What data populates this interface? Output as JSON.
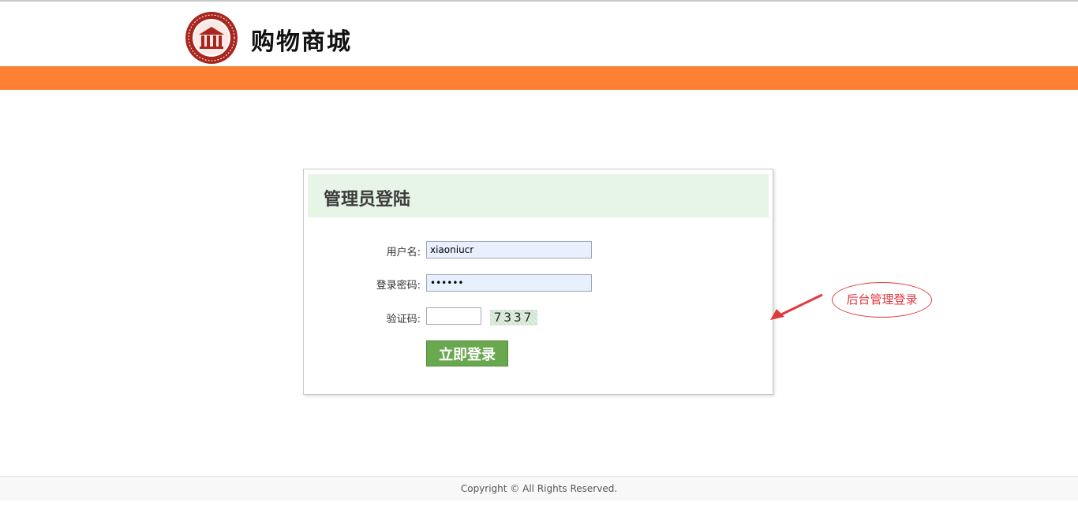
{
  "header": {
    "site_title": "购物商城",
    "logo_icon": "university-seal-logo",
    "brand_color": "#fe8034"
  },
  "login": {
    "title": "管理员登陆",
    "username_label": "用户名:",
    "username_value": "xiaoniucr",
    "password_label": "登录密码:",
    "password_value": "••••••",
    "captcha_label": "验证码:",
    "captcha_value": "",
    "captcha_text": "7337",
    "submit_label": "立即登录",
    "head_color": "#e7f5e7",
    "button_color": "#6aa84f"
  },
  "annotation": {
    "text": "后台管理登录",
    "color": "#e0393e"
  },
  "footer": {
    "copyright": "Copyright © All Rights Reserved."
  }
}
